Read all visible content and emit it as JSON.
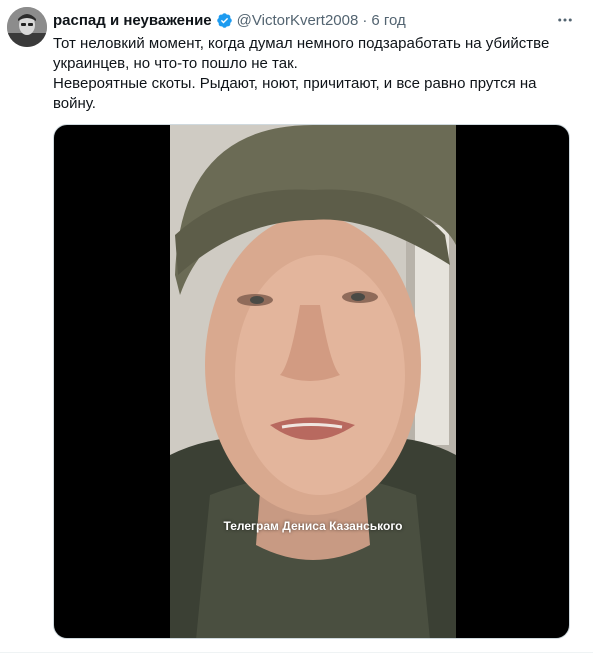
{
  "tweet": {
    "author_name": "распад и неуважение",
    "author_handle": "@VictorKvert2008",
    "separator": "·",
    "time": "6 год",
    "text_lines": [
      "Тот неловкий момент, когда думал немного подзаработать на убийстве украинцев, но что-то пошло не так.",
      "Невероятные скоты. Рыдают, ноют, причитают, и все равно прутся на войну."
    ]
  },
  "media": {
    "watermark": "Телеграм Дениса Казанського"
  },
  "icons": {
    "verified": "verified-badge-icon",
    "more": "more-options-icon"
  },
  "colors": {
    "verified": "#1d9bf0",
    "text_primary": "#0f1419",
    "text_secondary": "#536471"
  }
}
